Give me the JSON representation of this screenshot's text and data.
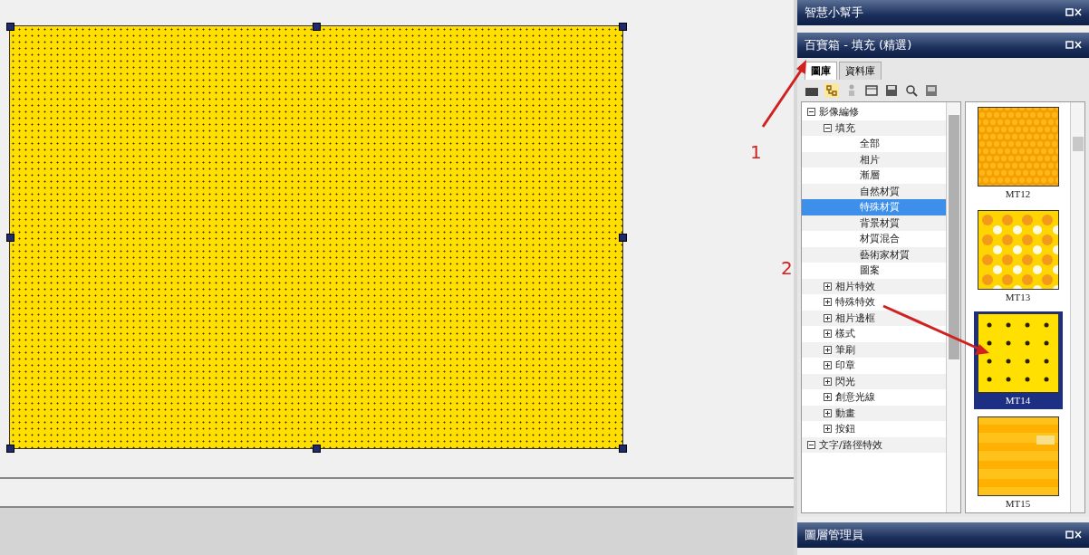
{
  "canvas": {
    "object": {
      "kind": "dots",
      "selected": true
    }
  },
  "annotations": [
    {
      "label": "1"
    },
    {
      "label": "2"
    }
  ],
  "panels": [
    {
      "title": "智慧小幫手",
      "kind": "collapsed"
    },
    {
      "title": "百寶箱 - 填充 (精選)",
      "kind": "easypalette"
    }
  ],
  "tabs": [
    {
      "label": "圖庫",
      "selected": true
    },
    {
      "label": "資料庫",
      "selected": false
    }
  ],
  "tree": [
    {
      "label": "影像編修",
      "kind": "group",
      "expanded": true,
      "selected": false,
      "children": [
        {
          "label": "填充",
          "kind": "group",
          "expanded": true,
          "selected": false,
          "children": [
            {
              "label": "全部",
              "kind": "leaf",
              "selected": false
            },
            {
              "label": "相片",
              "kind": "leaf",
              "selected": false
            },
            {
              "label": "漸層",
              "kind": "leaf",
              "selected": false
            },
            {
              "label": "自然材質",
              "kind": "leaf",
              "selected": false
            },
            {
              "label": "特殊材質",
              "kind": "leaf",
              "selected": true
            },
            {
              "label": "背景材質",
              "kind": "leaf",
              "selected": false
            },
            {
              "label": "材質混合",
              "kind": "leaf",
              "selected": false
            },
            {
              "label": "藝術家材質",
              "kind": "leaf",
              "selected": false
            },
            {
              "label": "圖案",
              "kind": "leaf",
              "selected": false
            }
          ]
        },
        {
          "label": "相片特效",
          "kind": "group",
          "expanded": false,
          "selected": false
        },
        {
          "label": "特殊特效",
          "kind": "group",
          "expanded": false,
          "selected": false
        },
        {
          "label": "相片邊框",
          "kind": "group",
          "expanded": false,
          "selected": false
        },
        {
          "label": "樣式",
          "kind": "group",
          "expanded": false,
          "selected": false
        },
        {
          "label": "筆刷",
          "kind": "group",
          "expanded": false,
          "selected": false
        },
        {
          "label": "印章",
          "kind": "group",
          "expanded": false,
          "selected": false
        },
        {
          "label": "閃光",
          "kind": "group",
          "expanded": false,
          "selected": false
        },
        {
          "label": "創意光線",
          "kind": "group",
          "expanded": false,
          "selected": false
        },
        {
          "label": "動畫",
          "kind": "group",
          "expanded": false,
          "selected": false
        },
        {
          "label": "按鈕",
          "kind": "group",
          "expanded": false,
          "selected": false
        }
      ]
    },
    {
      "label": "文字/路徑特效",
      "kind": "group",
      "expanded": true,
      "selected": false
    }
  ],
  "gallery": [
    {
      "label": "MT12",
      "kind": "honeycomb",
      "selected": false
    },
    {
      "label": "MT13",
      "kind": "checks",
      "selected": false
    },
    {
      "label": "MT14",
      "kind": "dots",
      "selected": true
    },
    {
      "label": "MT15",
      "kind": "stripes",
      "selected": false
    }
  ],
  "bottom_panels": [
    {
      "title": "圖層管理員"
    }
  ]
}
